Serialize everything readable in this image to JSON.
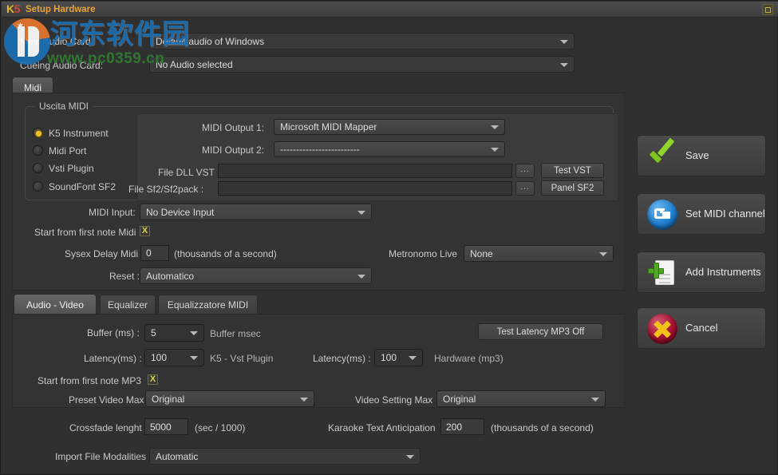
{
  "window": {
    "logo_k": "K",
    "logo_5": "5",
    "title": "Setup Hardware",
    "restore_icon": "restore-icon"
  },
  "watermark": {
    "chinese": "河东软件园",
    "url": "www.pc0359.cn"
  },
  "audio_cards": {
    "main_label": "Main Audio Card:",
    "main_value": "Default audio of Windows",
    "cueing_label": "Cueing Audio Card:",
    "cueing_value": "No Audio selected"
  },
  "midi_tab": {
    "label": "Midi"
  },
  "uscita": {
    "group_title": "Uscita MIDI",
    "radios": [
      {
        "label": "K5 Instrument",
        "selected": true
      },
      {
        "label": "Midi Port",
        "selected": false
      },
      {
        "label": "Vsti Plugin",
        "selected": false
      },
      {
        "label": "SoundFont SF2",
        "selected": false
      }
    ],
    "midi_output1_label": "MIDI Output 1:",
    "midi_output1_value": "Microsoft MIDI Mapper",
    "midi_output2_label": "MIDI Output 2:",
    "midi_output2_value": "-------------------------",
    "file_dll_label": "File DLL VST :",
    "file_dll_value": "",
    "file_sf2_label": "File Sf2/Sf2pack :",
    "file_sf2_value": "",
    "browse_label": "...",
    "test_vst_label": "Test VST",
    "panel_sf2_label": "Panel SF2"
  },
  "midi_settings": {
    "midi_input_label": "MIDI Input:",
    "midi_input_value": "No Device Input",
    "start_first_note_label": "Start from first note Midi",
    "start_first_note_checked": "X",
    "sysex_label": "Sysex Delay Midi :",
    "sysex_value": "0",
    "sysex_units": "(thousands of a second)",
    "metronome_label": "Metronomo Live",
    "metronome_value": "None",
    "reset_label": "Reset :",
    "reset_value": "Automatico"
  },
  "av_tabs": [
    {
      "label": "Audio - Video",
      "active": true
    },
    {
      "label": "Equalizer",
      "active": false
    },
    {
      "label": "Equalizzatore MIDI",
      "active": false
    }
  ],
  "av": {
    "buffer_label": "Buffer (ms) :",
    "buffer_value": "5",
    "buffer_suffix": "Buffer msec",
    "latency1_label": "Latency(ms) :",
    "latency1_value": "100",
    "latency1_suffix": "K5 - Vst Plugin",
    "latency2_label": "Latency(ms) :",
    "latency2_value": "100",
    "latency2_suffix": "Hardware (mp3)",
    "test_latency_label": "Test Latency MP3 Off",
    "start_first_note_mp3_label": "Start from first note MP3",
    "start_first_note_mp3_checked": "X",
    "preset_video_label": "Preset Video Max",
    "preset_video_value": "Original",
    "video_setting_label": "Video Setting Max",
    "video_setting_value": "Original"
  },
  "bottom": {
    "crossfade_label": "Crossfade lenght",
    "crossfade_value": "5000",
    "crossfade_units": "(sec / 1000)",
    "karaoke_label": "Karaoke Text Anticipation",
    "karaoke_value": "200",
    "karaoke_units": "(thousands of a second)",
    "import_label": "Import File Modalities",
    "import_value": "Automatic"
  },
  "buttons": {
    "save": "Save",
    "set_midi_channel": "Set MIDI channel",
    "add_instruments": "Add Instruments",
    "cancel": "Cancel"
  }
}
